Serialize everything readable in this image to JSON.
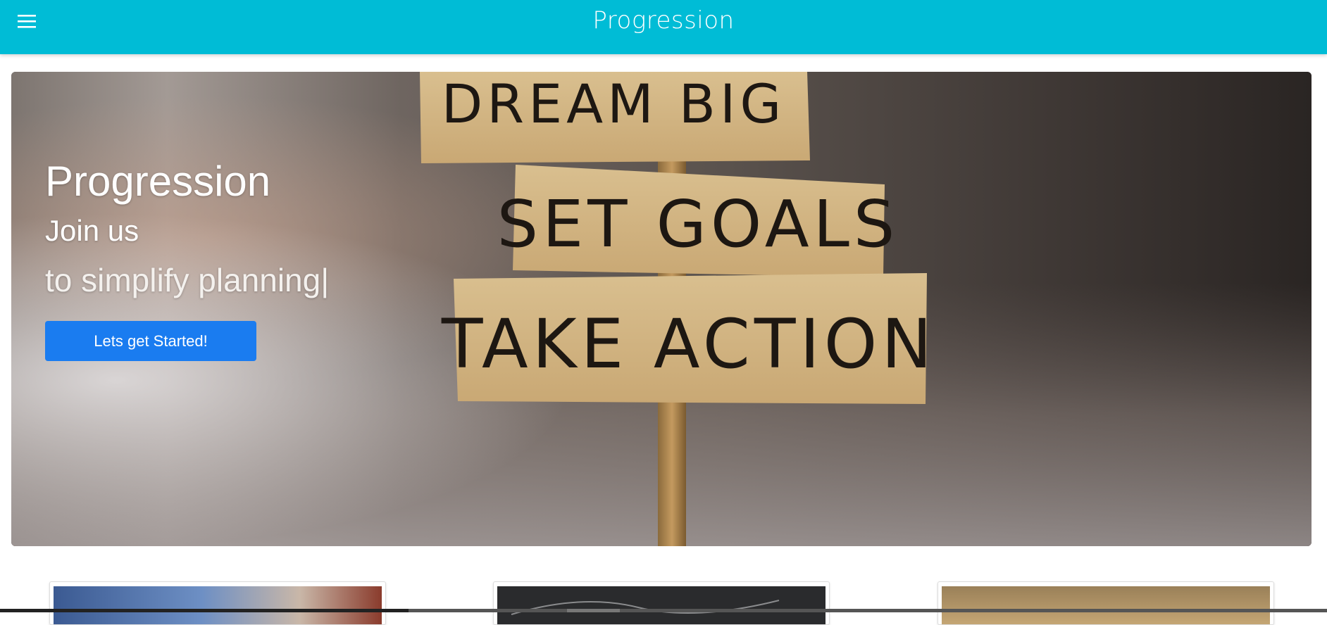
{
  "header": {
    "title": "Progression",
    "menu_icon": "hamburger-menu-icon",
    "background_color": "#00bcd6"
  },
  "hero": {
    "title": "Progression",
    "subtitle_line1": "Join us",
    "subtitle_line2": "to simplify planning|",
    "cta_label": "Lets get Started!",
    "cta_color": "#1a7cf0",
    "sign_lines": [
      "DREAM BIG",
      "SET GOALS",
      "TAKE ACTION"
    ]
  }
}
